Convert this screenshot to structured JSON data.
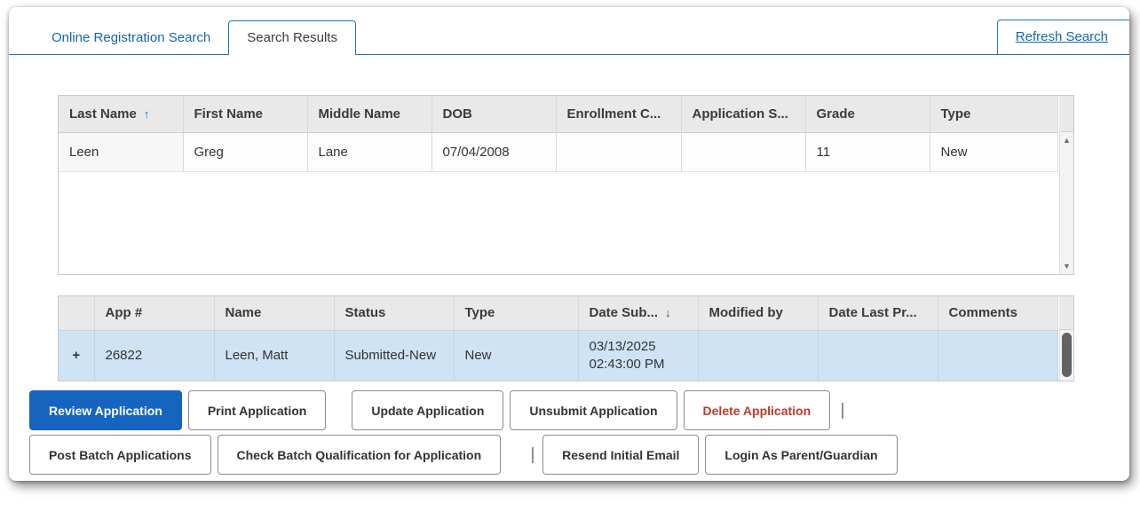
{
  "colors": {
    "accent_blue": "#2077b8",
    "link_blue": "#1467b0",
    "primary_button_blue": "#1565c0",
    "delete_red": "#c0392b",
    "selected_row_blue": "#cfe3f5",
    "header_gray": "#e9e9e9"
  },
  "tabs": {
    "online_registration_search": "Online Registration Search",
    "search_results": "Search Results",
    "refresh_search": "Refresh Search"
  },
  "icons": {
    "sort_asc": "↑",
    "sort_desc": "↓",
    "scroll_up": "▲",
    "scroll_down": "▼",
    "expand_row": "+"
  },
  "students_table": {
    "columns": [
      "Last Name",
      "First Name",
      "Middle Name",
      "DOB",
      "Enrollment C...",
      "Application S...",
      "Grade",
      "Type"
    ],
    "sorted_column": "Last Name",
    "sort_direction": "ascending",
    "rows": [
      {
        "last_name": "Leen",
        "first_name": "Greg",
        "middle_name": "Lane",
        "dob": "07/04/2008",
        "enrollment": "",
        "application": "",
        "grade": "11",
        "type": "New"
      }
    ]
  },
  "applications_table": {
    "columns": [
      "App #",
      "Name",
      "Status",
      "Type",
      "Date Sub...",
      "Modified by",
      "Date Last Pr...",
      "Comments"
    ],
    "sorted_column": "Date Sub...",
    "sort_direction": "descending",
    "rows": [
      {
        "app_number": "26822",
        "name": "Leen, Matt",
        "status": "Submitted-New",
        "type": "New",
        "date_submitted": "03/13/2025 02:43:00 PM",
        "modified_by": "",
        "date_last_printed": "",
        "comments": "",
        "selected": true
      }
    ]
  },
  "actions": {
    "row1": [
      "Review Application",
      "Print Application",
      "Update Application",
      "Unsubmit Application",
      "Delete Application"
    ],
    "row2": [
      "Post Batch Applications",
      "Check Batch Qualification for Application",
      "Resend Initial Email",
      "Login As Parent/Guardian"
    ]
  }
}
